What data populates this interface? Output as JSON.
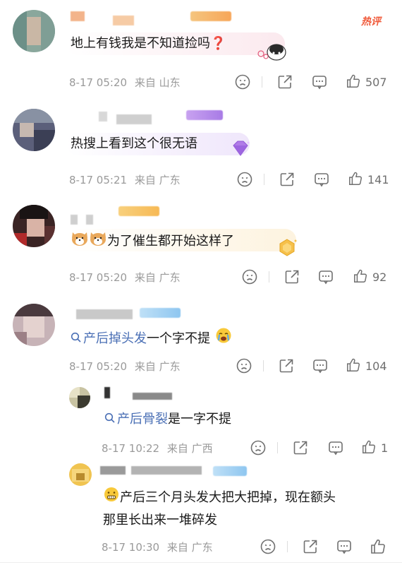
{
  "comments": [
    {
      "badge": "热评",
      "text": "地上有钱我是不知道捡吗❓",
      "time": "8-17 05:20",
      "location": "来自 山东",
      "likes": "507"
    },
    {
      "text": "热搜上看到这个很无语",
      "time": "8-17 05:21",
      "location": "来自 广东",
      "likes": "141"
    },
    {
      "text": "为了催生都开始这样了",
      "time": "8-17 05:20",
      "location": "来自 广东",
      "likes": "92"
    },
    {
      "search_term": "产后掉头发",
      "text_after": "一个字不提",
      "time": "8-17 05:20",
      "location": "来自 广东",
      "likes": "104"
    }
  ],
  "replies": [
    {
      "search_term": "产后骨裂",
      "text_after": "是一字不提",
      "time": "8-17 10:22",
      "location": "来自 广西",
      "likes": "1"
    },
    {
      "text_line1": "产后三个月头发大把大把掉，现在额头",
      "text_line2": "那里长出来一堆碎发",
      "time": "8-17 10:30",
      "location": "来自 广东"
    }
  ],
  "icons": {
    "search": "search-icon",
    "dislike": "dislike-face-icon",
    "share": "share-icon",
    "reply": "comment-bubble-icon",
    "like": "thumbs-up-icon"
  }
}
